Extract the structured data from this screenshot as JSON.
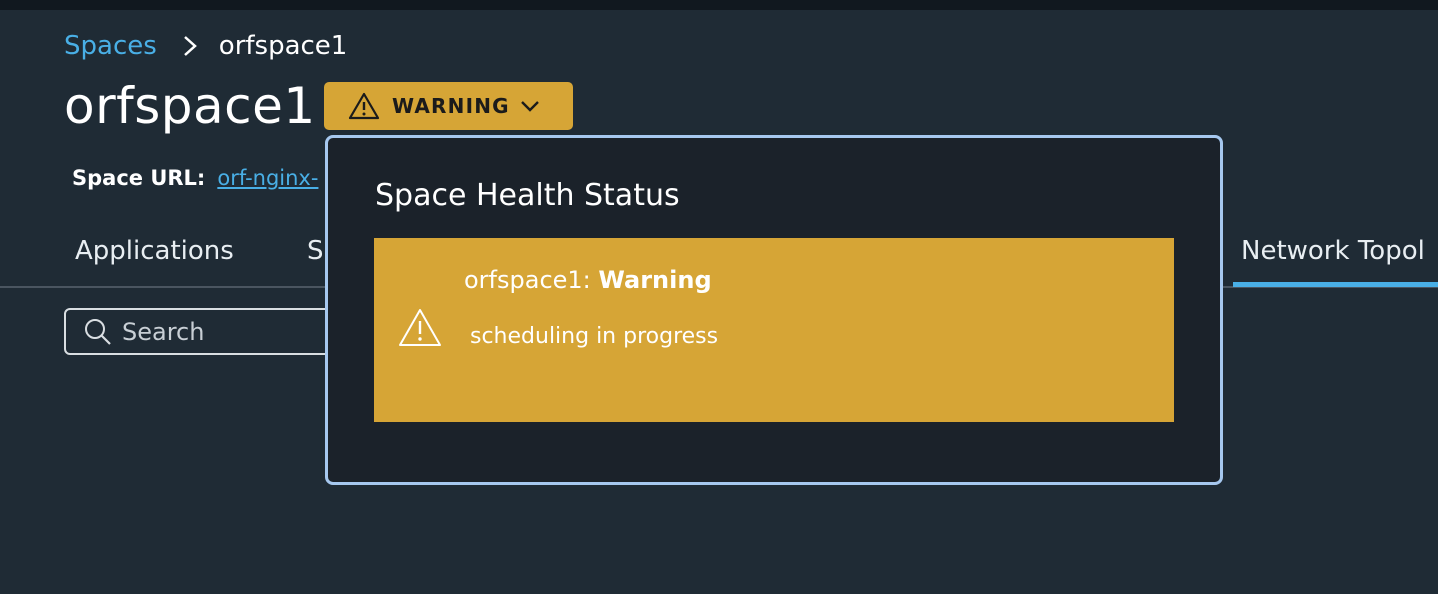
{
  "breadcrumb": {
    "parent": "Spaces",
    "current": "orfspace1"
  },
  "page": {
    "title": "orfspace1",
    "status_badge": "WARNING"
  },
  "space_url": {
    "label": "Space URL:",
    "value": "orf-nginx-"
  },
  "tabs": [
    {
      "label": "Applications"
    },
    {
      "label": "S"
    },
    {
      "label": "Network Topol",
      "active": true
    }
  ],
  "search": {
    "placeholder": "Search",
    "value": ""
  },
  "health_popover": {
    "title": "Space Health Status",
    "alert": {
      "space_name": "orfspace1: ",
      "status": "Warning",
      "message": "scheduling in progress",
      "icon": "warning-triangle-icon"
    }
  },
  "colors": {
    "background": "#1f2b35",
    "accent_blue": "#49afe6",
    "warning": "#d6a536",
    "popover_bg": "#1b222a",
    "popover_border": "#a6c8ef"
  }
}
